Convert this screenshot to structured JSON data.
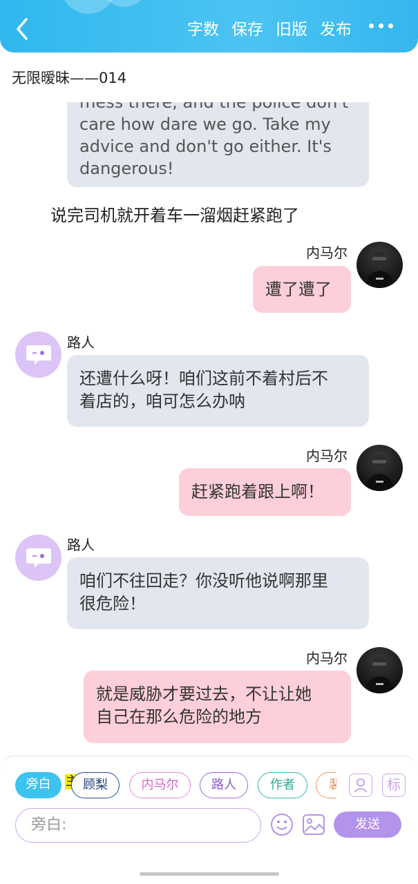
{
  "header": {
    "actions": [
      "字数",
      "保存",
      "旧版",
      "发布"
    ]
  },
  "doc_title": "无限暧昧——014",
  "messages": {
    "m1": {
      "type": "gray-bubble",
      "lines": [
        "mess there, and the police don't",
        "care how dare we go. Take my",
        "advice and don't go either. It's",
        "dangerous!"
      ]
    },
    "narration": "说完司机就开着车一溜烟赶紧跑了",
    "m2": {
      "speaker": "内马尔",
      "text": "遭了遭了"
    },
    "m3": {
      "speaker": "路人",
      "lines": [
        "还遭什么呀！咱们这前不着村后不",
        "着店的，咱可怎么办呐"
      ]
    },
    "m4": {
      "speaker": "内马尔",
      "text": "赶紧跑着跟上啊！"
    },
    "m5": {
      "speaker": "路人",
      "lines": [
        "咱们不往回走？你没听他说啊那里",
        "很危险！"
      ]
    },
    "m6": {
      "speaker": "内马尔",
      "lines": [
        "就是威胁才要过去，不让让她",
        "自己在那么危险的地方"
      ]
    }
  },
  "composer": {
    "chips": [
      "旁白",
      "顾梨",
      "内马尔",
      "路人",
      "作者",
      "裴"
    ],
    "main_tag": "主",
    "side_icons": [
      "person-card-icon",
      "tag-icon"
    ],
    "side_label": "标",
    "input_placeholder": "旁白:",
    "send_label": "发送"
  },
  "colors": {
    "header": "#3bbcf0",
    "gray_bubble": "#e2e6ee",
    "pink_bubble": "#fdcfd8",
    "active_chip": "#3dc3ef",
    "send": "#b493ec"
  }
}
